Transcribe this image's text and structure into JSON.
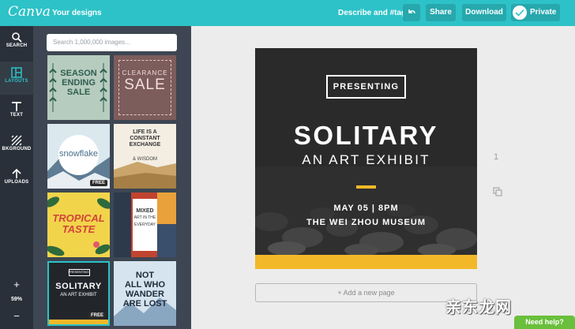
{
  "colors": {
    "brand": "#2dc2c7",
    "nav_bg": "#293039",
    "panel_bg": "#3d4652",
    "poster_accent": "#f3b829",
    "help_green": "#6abf3c"
  },
  "header": {
    "logo": "Canva",
    "your_designs": "Your designs",
    "describe": "Describe and #tag",
    "undo_icon": "undo-icon",
    "share": "Share",
    "download": "Download",
    "private": "Private"
  },
  "nav": {
    "items": [
      {
        "label": "SEARCH",
        "icon": "search-icon"
      },
      {
        "label": "LAYOUTS",
        "icon": "layouts-icon"
      },
      {
        "label": "TEXT",
        "icon": "text-icon"
      },
      {
        "label": "BKGROUND",
        "icon": "background-icon"
      },
      {
        "label": "UPLOADS",
        "icon": "upload-icon"
      }
    ],
    "zoom_plus": "+",
    "zoom": "59%",
    "zoom_minus": "−"
  },
  "panel": {
    "search_placeholder": "Search 1,000,000 images...",
    "thumbs": [
      {
        "line1": "SEASON",
        "line2": "ENDING",
        "line3": "SALE"
      },
      {
        "line1": "CLEARANCE",
        "line2": "SALE"
      },
      {
        "line1": "snowflake",
        "badge": "FREE"
      },
      {
        "line1": "LIFE IS A",
        "line2": "CONSTANT",
        "line3": "EXCHANGE",
        "line4": "& WISDOM"
      },
      {
        "line1": "TROPICAL",
        "line2": "TASTE"
      },
      {
        "line1": "MIXED",
        "line2": "ART IN THE",
        "line3": "EVERYDAY"
      },
      {
        "line1": "PRESENTING",
        "line2": "SOLITARY",
        "line3": "AN ART EXHIBIT",
        "badge": "FREE"
      },
      {
        "line1": "NOT",
        "line2": "ALL WHO",
        "line3": "WANDER",
        "line4": "ARE LOST"
      }
    ]
  },
  "poster": {
    "presenting": "PRESENTING",
    "title": "SOLITARY",
    "subtitle": "AN ART EXHIBIT",
    "date": "MAY 05 | 8PM",
    "venue": "THE WEI ZHOU MUSEUM"
  },
  "canvas": {
    "page_number": "1",
    "copy_icon": "copy-page-icon",
    "add_page": "+ Add a new page",
    "watermark": "亲东龙网",
    "need_help": "Need help?"
  }
}
